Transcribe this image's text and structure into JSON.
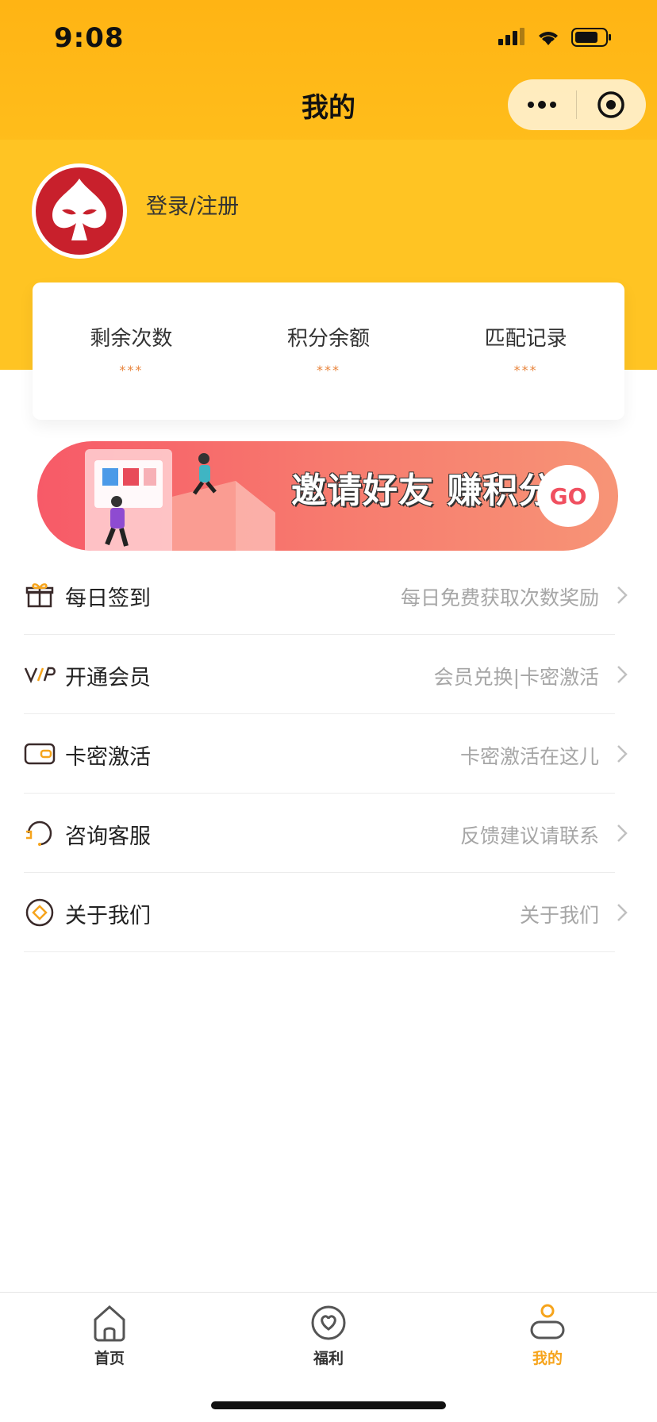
{
  "status_bar": {
    "time": "9:08"
  },
  "nav": {
    "title": "我的"
  },
  "profile": {
    "login_label": "登录/注册"
  },
  "stats": [
    {
      "label": "剩余次数",
      "value": "***"
    },
    {
      "label": "积分余额",
      "value": "***"
    },
    {
      "label": "匹配记录",
      "value": "***"
    }
  ],
  "banner": {
    "text": "邀请好友 赚积分",
    "go_label": "GO"
  },
  "menu": [
    {
      "label": "每日签到",
      "desc": "每日免费获取次数奖励",
      "icon": "gift-icon"
    },
    {
      "label": "开通会员",
      "desc": "会员兑换|卡密激活",
      "icon": "vip-icon"
    },
    {
      "label": "卡密激活",
      "desc": "卡密激活在这儿",
      "icon": "wallet-icon"
    },
    {
      "label": "咨询客服",
      "desc": "反馈建议请联系",
      "icon": "headset-icon"
    },
    {
      "label": "关于我们",
      "desc": "关于我们",
      "icon": "info-diamond-icon"
    }
  ],
  "tabbar": [
    {
      "label": "首页",
      "icon": "home-icon",
      "active": false
    },
    {
      "label": "福利",
      "icon": "heart-icon",
      "active": false
    },
    {
      "label": "我的",
      "icon": "profile-icon",
      "active": true
    }
  ],
  "colors": {
    "header": "#ffc423",
    "accent": "#f6a41c",
    "banner": "#f75a68",
    "avatar": "#c8202c"
  }
}
